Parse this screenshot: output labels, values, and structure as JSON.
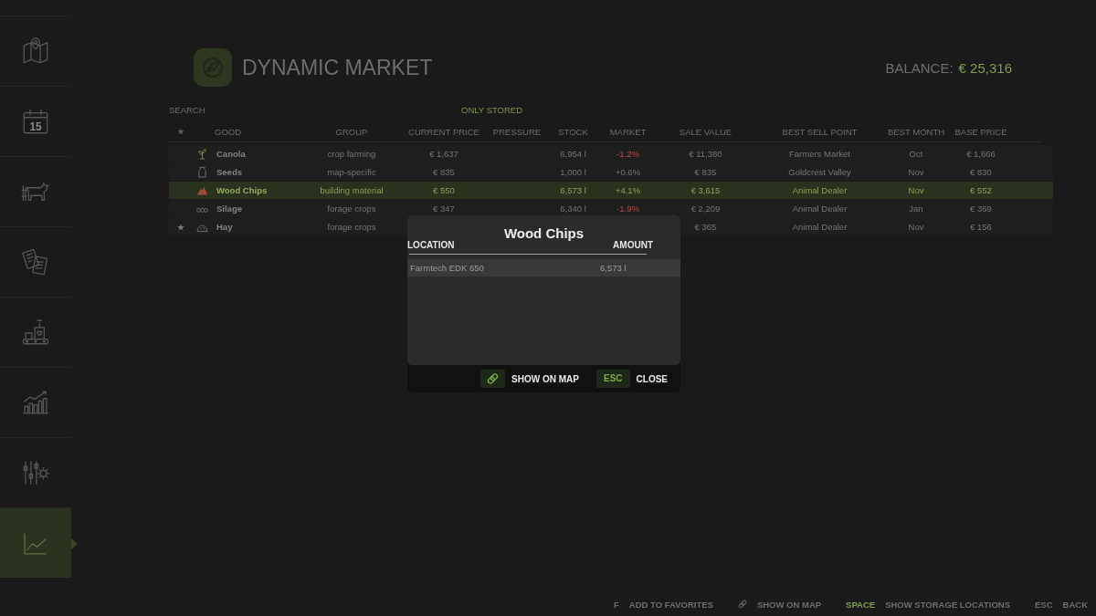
{
  "sidebar": {
    "items": [
      {
        "selected": false
      },
      {
        "selected": false,
        "day": "15"
      },
      {
        "selected": false
      },
      {
        "selected": false
      },
      {
        "selected": false
      },
      {
        "selected": false
      },
      {
        "selected": false
      },
      {
        "selected": true
      }
    ]
  },
  "header": {
    "title": "DYNAMIC MARKET",
    "balance_label": "BALANCE:",
    "balance_value": "€ 25,316"
  },
  "filters": {
    "search": {
      "placeholder": "SEARCH"
    },
    "only_stored": "ONLY STORED"
  },
  "table": {
    "columns": [
      "GOOD",
      "GROUP",
      "CURRENT PRICE",
      "PRESSURE",
      "STOCK",
      "MARKET",
      "SALE VALUE",
      "BEST SELL POINT",
      "BEST MONTH",
      "BASE PRICE"
    ],
    "rows": [
      {
        "favorite": false,
        "selected": false,
        "good": "Canola",
        "group": "crop farming",
        "current_price": "€ 1,637",
        "stock": "6,954 l",
        "market": "-1.2%",
        "falling": true,
        "sale_value": "€ 11,380",
        "best_sell_point": "Farmers Market",
        "best_month": "Oct",
        "base_price": "€ 1,666"
      },
      {
        "favorite": false,
        "selected": false,
        "good": "Seeds",
        "group": "map-specific",
        "current_price": "€ 835",
        "stock": "1,000 l",
        "market": "+0.6%",
        "falling": false,
        "sale_value": "€ 835",
        "best_sell_point": "Goldcrest Valley",
        "best_month": "Nov",
        "base_price": "€ 830"
      },
      {
        "favorite": false,
        "selected": true,
        "good": "Wood Chips",
        "group": "building material",
        "current_price": "€ 550",
        "stock": "6,573 l",
        "market": "+4.1%",
        "falling": false,
        "sale_value": "€ 3,615",
        "best_sell_point": "Animal Dealer",
        "best_month": "Nov",
        "base_price": "€ 552"
      },
      {
        "favorite": false,
        "selected": false,
        "good": "Silage",
        "group": "forage crops",
        "current_price": "€ 347",
        "stock": "6,340 l",
        "market": "-1.9%",
        "falling": true,
        "sale_value": "€ 2,209",
        "best_sell_point": "Animal Dealer",
        "best_month": "Jan",
        "base_price": "€ 369"
      },
      {
        "favorite": true,
        "selected": false,
        "good": "Hay",
        "group": "forage crops",
        "sale_value": "€ 365",
        "best_sell_point": "Animal Dealer",
        "best_month": "Nov",
        "base_price": "€ 156"
      }
    ]
  },
  "dialog": {
    "title": "Wood Chips",
    "columns": [
      "LOCATION",
      "AMOUNT"
    ],
    "rows": [
      {
        "location": "Farmtech EDK 650",
        "amount": "6,573 l"
      }
    ],
    "buttons": [
      {
        "kind": "icon",
        "label": "SHOW ON MAP"
      },
      {
        "kind": "key",
        "key": "ESC",
        "label": "CLOSE"
      }
    ]
  },
  "footer": {
    "actions": [
      {
        "kind": "key",
        "key": "F",
        "label": "ADD TO FAVORITES",
        "accent": false
      },
      {
        "kind": "icon",
        "label": "SHOW ON MAP"
      },
      {
        "kind": "key",
        "key": "SPACE",
        "label": "SHOW STORAGE LOCATIONS",
        "accent": true
      },
      {
        "kind": "key",
        "key": "ESC",
        "label": "BACK",
        "accent": false
      }
    ]
  }
}
